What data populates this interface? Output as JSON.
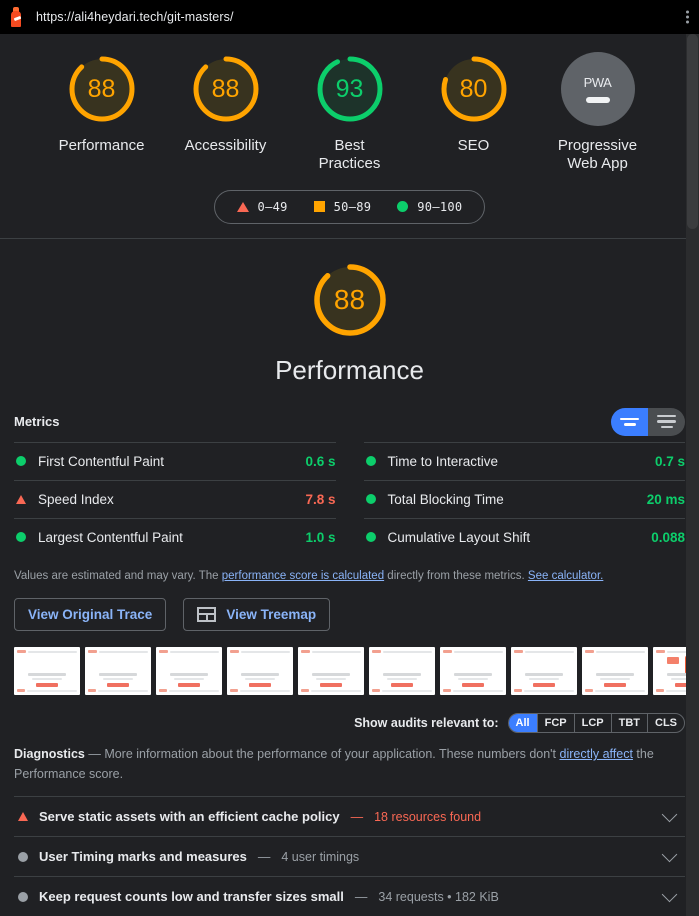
{
  "urlbar": {
    "url": "https://ali4heydari.tech/git-masters/",
    "icon": "lighthouse-icon",
    "menu_icon": "kebab-menu-icon"
  },
  "gauges": [
    {
      "score": "88",
      "label": "Performance",
      "color": "#ffa400",
      "pct": 88
    },
    {
      "score": "88",
      "label": "Accessibility",
      "color": "#ffa400",
      "pct": 88
    },
    {
      "score": "93",
      "label": "Best\nPractices",
      "color": "#0cce6b",
      "pct": 93
    },
    {
      "score": "80",
      "label": "SEO",
      "color": "#ffa400",
      "pct": 80
    },
    {
      "score": "PWA",
      "label": "Progressive\nWeb App",
      "color": "#5f6368",
      "pct": 0
    }
  ],
  "legend": [
    {
      "shape": "triangle",
      "label": "0–49",
      "color": "#f96854"
    },
    {
      "shape": "square",
      "label": "50–89",
      "color": "#ffa400"
    },
    {
      "shape": "circle",
      "label": "90–100",
      "color": "#0cce6b"
    }
  ],
  "hero": {
    "score": "88",
    "title": "Performance",
    "color": "#ffa400",
    "pct": 88
  },
  "metrics_section": {
    "title": "Metrics",
    "toggle": {
      "expand_icon": "expand-view-icon",
      "list_icon": "list-view-icon",
      "active": "expand"
    },
    "left": [
      {
        "name": "First Contentful Paint",
        "value": "0.6 s",
        "rating": "good"
      },
      {
        "name": "Speed Index",
        "value": "7.8 s",
        "rating": "fail"
      },
      {
        "name": "Largest Contentful Paint",
        "value": "1.0 s",
        "rating": "good"
      }
    ],
    "right": [
      {
        "name": "Time to Interactive",
        "value": "0.7 s",
        "rating": "good"
      },
      {
        "name": "Total Blocking Time",
        "value": "20 ms",
        "rating": "good"
      },
      {
        "name": "Cumulative Layout Shift",
        "value": "0.088",
        "rating": "good"
      }
    ]
  },
  "disclaimer": {
    "part1": "Values are estimated and may vary. The ",
    "link1": "performance score is calculated",
    "part2": " directly from these metrics. ",
    "link2": "See calculator."
  },
  "buttons": {
    "original_trace": "View Original Trace",
    "treemap": "View Treemap",
    "treemap_icon": "treemap-icon"
  },
  "filmstrip": {
    "count": 10,
    "thumb_name": "screenshot-thumbnail"
  },
  "audit_filter": {
    "label": "Show audits relevant to:",
    "pills": [
      "All",
      "FCP",
      "LCP",
      "TBT",
      "CLS"
    ],
    "active": "All"
  },
  "diagnostics": {
    "heading": "Diagnostics",
    "dash": " — ",
    "text1": "More information about the performance of your application. These numbers don't ",
    "link": "directly affect",
    "text2": " the Performance score."
  },
  "audits": [
    {
      "title": "Serve static assets with an efficient cache policy",
      "dash": "—",
      "sub": "18 resources found",
      "rating": "fail",
      "chevron": "chevron-down-icon"
    },
    {
      "title": "User Timing marks and measures",
      "dash": "—",
      "sub": "4 user timings",
      "rating": "info",
      "chevron": "chevron-down-icon"
    },
    {
      "title": "Keep request counts low and transfer sizes small",
      "dash": "—",
      "sub": "34 requests • 182 KiB",
      "rating": "info",
      "chevron": "chevron-down-icon"
    }
  ],
  "colors": {
    "bg": "#202124",
    "good": "#0cce6b",
    "average": "#ffa400",
    "fail": "#f96854",
    "link": "#8ab4f8",
    "accent_blue": "#3b7eff"
  }
}
